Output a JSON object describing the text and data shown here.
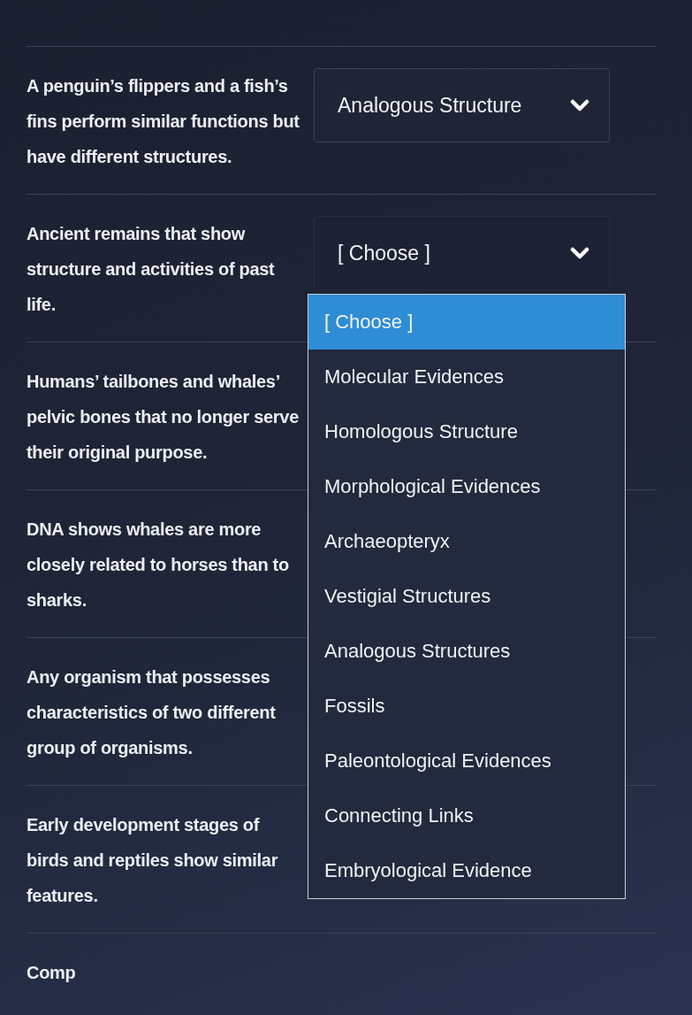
{
  "questions": [
    {
      "prompt": "A penguin’s flippers and a fish’s fins perform similar functions but have different structures.",
      "select": {
        "value": "Analogous Structure",
        "open": false
      }
    },
    {
      "prompt": "Ancient remains that show structure and activities of past life.",
      "select": {
        "value": "[ Choose ]",
        "open": true,
        "options": [
          {
            "label": "[ Choose ]",
            "selected": true
          },
          {
            "label": "Molecular Evidences",
            "selected": false
          },
          {
            "label": "Homologous Structure",
            "selected": false
          },
          {
            "label": "Morphological Evidences",
            "selected": false
          },
          {
            "label": "Archaeopteryx",
            "selected": false
          },
          {
            "label": "Vestigial Structures",
            "selected": false
          },
          {
            "label": "Analogous Structures",
            "selected": false
          },
          {
            "label": "Fossils",
            "selected": false
          },
          {
            "label": "Paleontological Evidences",
            "selected": false
          },
          {
            "label": "Connecting Links",
            "selected": false
          },
          {
            "label": "Embryological Evidence",
            "selected": false
          }
        ]
      }
    },
    {
      "prompt": "Humans’ tailbones and whales’ pelvic bones that no longer serve their original purpose."
    },
    {
      "prompt": "DNA shows whales are more closely related to horses than to sharks."
    },
    {
      "prompt": "Any organism that possesses characteristics of two different group of organisms."
    },
    {
      "prompt": "Early development stages of birds and reptiles show similar features."
    },
    {
      "prompt": "Comp"
    }
  ]
}
